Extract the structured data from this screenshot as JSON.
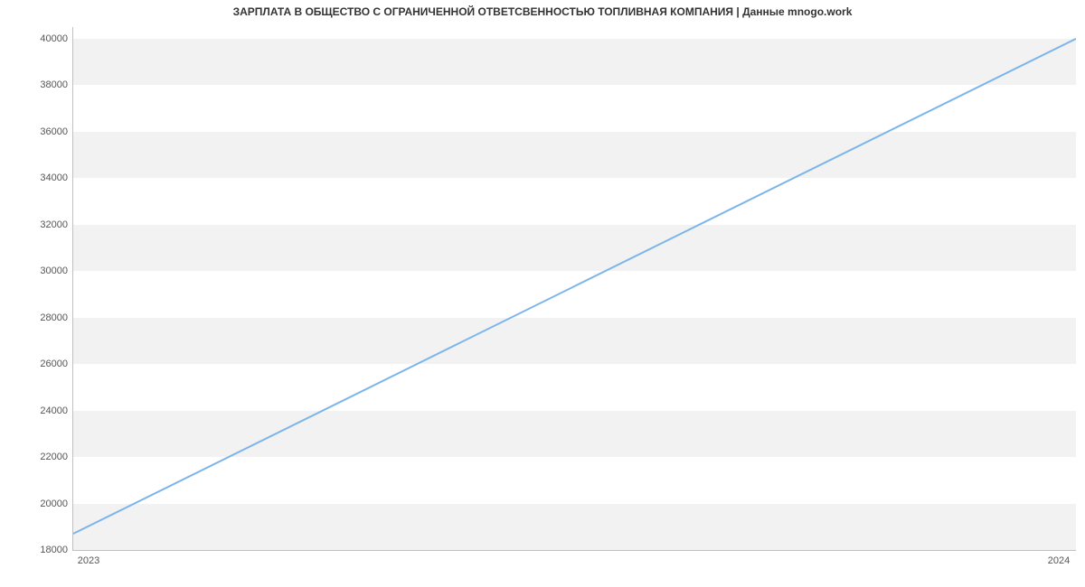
{
  "chart_data": {
    "type": "line",
    "title": "ЗАРПЛАТА В ОБЩЕСТВО С ОГРАНИЧЕННОЙ ОТВЕТСВЕННОСТЬЮ ТОПЛИВНАЯ КОМПАНИЯ | Данные mnogo.work",
    "x": [
      2023,
      2024
    ],
    "values": [
      18700,
      40000
    ],
    "xlabel": "",
    "ylabel": "",
    "xticks": [
      2023,
      2024
    ],
    "yticks": [
      18000,
      20000,
      22000,
      24000,
      26000,
      28000,
      30000,
      32000,
      34000,
      36000,
      38000,
      40000
    ],
    "ylim": [
      18000,
      40500
    ],
    "xlim": [
      2023,
      2024
    ],
    "line_color": "#7cb5ec",
    "band_color": "#f2f2f2"
  }
}
